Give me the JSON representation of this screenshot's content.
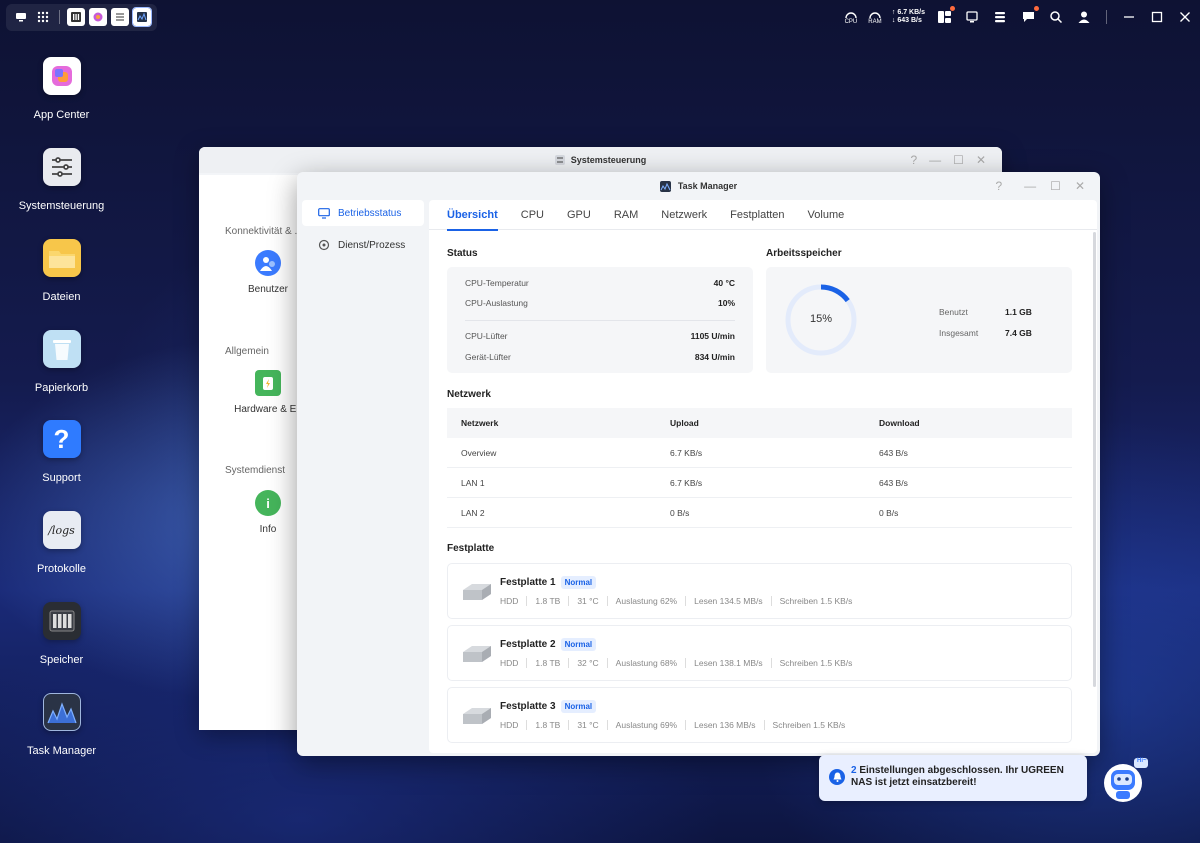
{
  "taskbar": {
    "cpu_label": "CPU",
    "ram_label": "RAM",
    "upload_rate": "6.7 KB/s",
    "download_rate": "643 B/s"
  },
  "desktop": [
    {
      "label": "App Center",
      "icon": "app-center-icon"
    },
    {
      "label": "Systemsteuerung",
      "icon": "control-panel-icon"
    },
    {
      "label": "Dateien",
      "icon": "folder-icon"
    },
    {
      "label": "Papierkorb",
      "icon": "trash-icon"
    },
    {
      "label": "Support",
      "icon": "help-icon"
    },
    {
      "label": "Protokolle",
      "icon": "logs-icon"
    },
    {
      "label": "Speicher",
      "icon": "storage-icon"
    },
    {
      "label": "Task Manager",
      "icon": "task-manager-icon"
    }
  ],
  "logs_icon_text": "/logs",
  "support_icon_text": "?",
  "sys_window": {
    "title": "Systemsteuerung",
    "help": "?",
    "sections": [
      {
        "label": "Konnektivität & ..",
        "item": "Benutzer"
      },
      {
        "label": "Allgemein",
        "item": "Hardware & En"
      },
      {
        "label": "Systemdienst",
        "item": "Info"
      }
    ]
  },
  "tm_window": {
    "title": "Task Manager",
    "help": "?",
    "sidebar": [
      {
        "label": "Betriebsstatus"
      },
      {
        "label": "Dienst/Prozess"
      }
    ],
    "tabs": [
      "Übersicht",
      "CPU",
      "GPU",
      "RAM",
      "Netzwerk",
      "Festplatten",
      "Volume"
    ],
    "status": {
      "heading": "Status",
      "rows": [
        {
          "label": "CPU-Temperatur",
          "value": "40 °C"
        },
        {
          "label": "CPU-Auslastung",
          "value": "10%"
        },
        {
          "label": "CPU-Lüfter",
          "value": "1105 U/min"
        },
        {
          "label": "Gerät-Lüfter",
          "value": "834 U/min"
        }
      ]
    },
    "memory": {
      "heading": "Arbeitsspeicher",
      "percent_label": "15%",
      "usage_fraction": 0.15,
      "used_label": "Benutzt",
      "used_value": "1.1 GB",
      "total_label": "Insgesamt",
      "total_value": "7.4 GB",
      "accent": "#1a62e6"
    },
    "network": {
      "heading": "Netzwerk",
      "columns": [
        "Netzwerk",
        "Upload",
        "Download"
      ],
      "rows": [
        [
          "Overview",
          "6.7 KB/s",
          "643 B/s"
        ],
        [
          "LAN 1",
          "6.7 KB/s",
          "643 B/s"
        ],
        [
          "LAN 2",
          "0 B/s",
          "0 B/s"
        ]
      ]
    },
    "disks": {
      "heading": "Festplatte",
      "items": [
        {
          "name": "Festplatte 1",
          "status": "Normal",
          "type": "HDD",
          "size": "1.8 TB",
          "temp": "31 °C",
          "load": "Auslastung 62%",
          "read": "Lesen 134.5 MB/s",
          "write": "Schreiben 1.5 KB/s"
        },
        {
          "name": "Festplatte 2",
          "status": "Normal",
          "type": "HDD",
          "size": "1.8 TB",
          "temp": "32 °C",
          "load": "Auslastung 68%",
          "read": "Lesen 138.1 MB/s",
          "write": "Schreiben 1.5 KB/s"
        },
        {
          "name": "Festplatte 3",
          "status": "Normal",
          "type": "HDD",
          "size": "1.8 TB",
          "temp": "31 °C",
          "load": "Auslastung 69%",
          "read": "Lesen 136 MB/s",
          "write": "Schreiben 1.5 KB/s"
        }
      ]
    }
  },
  "toast": {
    "count": "2",
    "text": " Einstellungen abgeschlossen. Ihr UGREEN NAS ist jetzt einsatzbereit!"
  },
  "assistant": {
    "bubble": "Hi~"
  }
}
